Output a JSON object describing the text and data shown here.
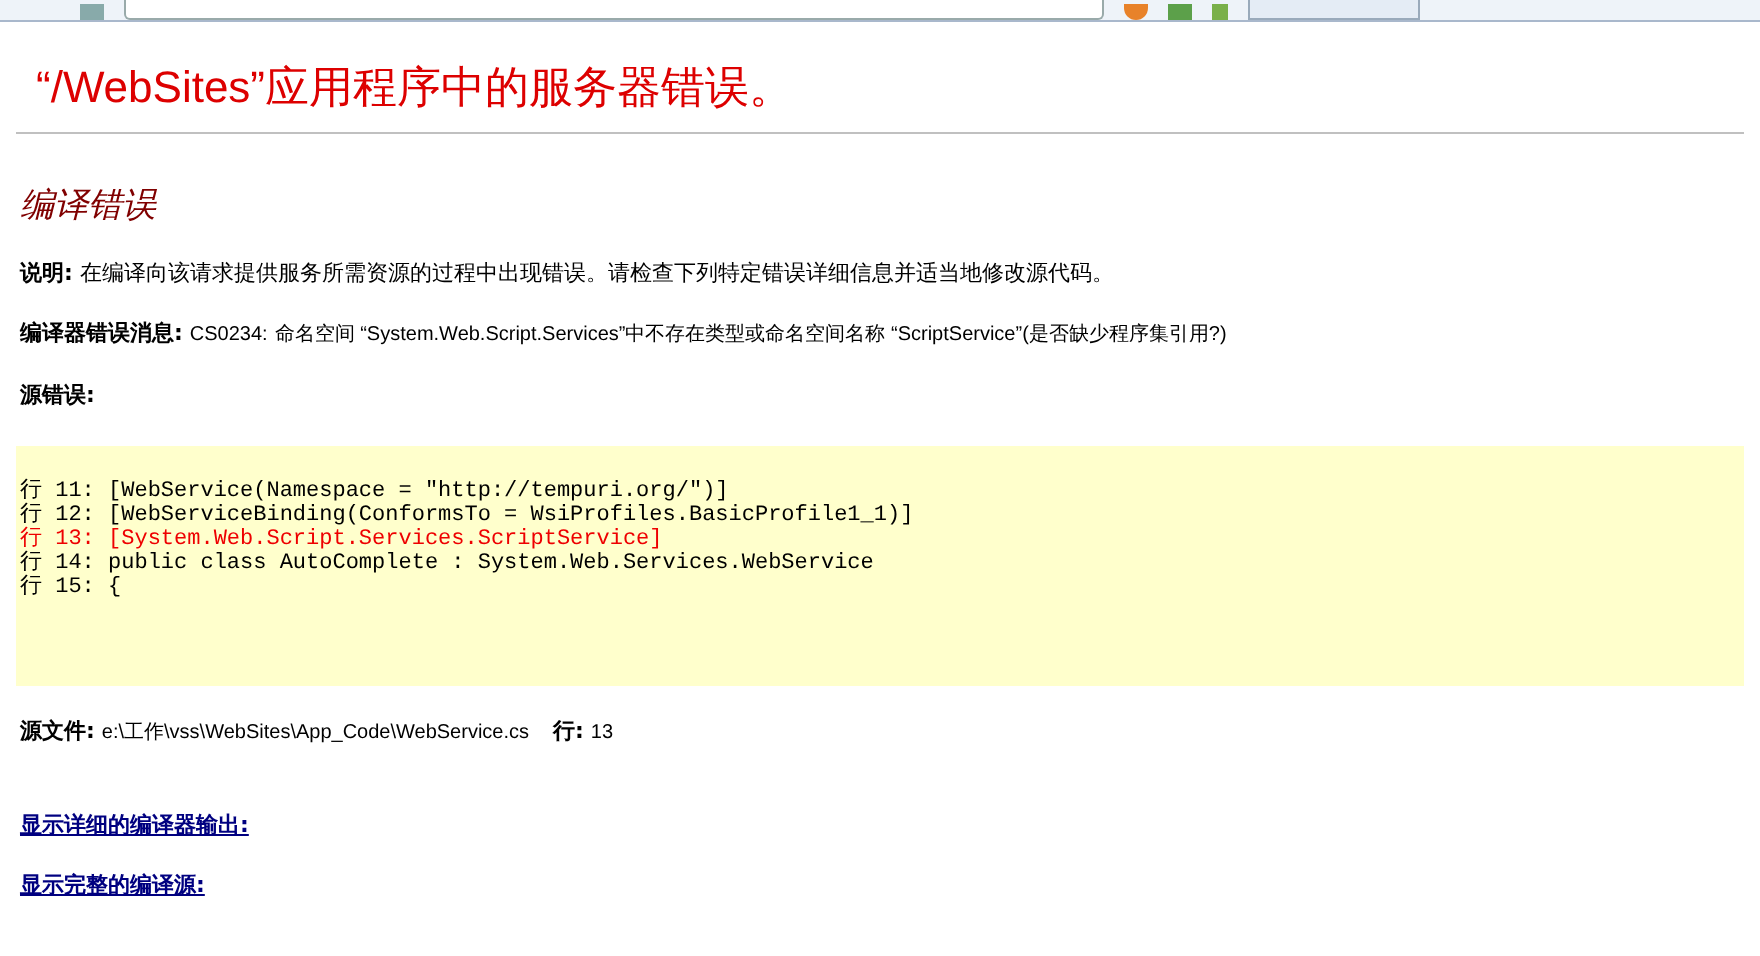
{
  "title": "“/WebSites”应用程序中的服务器错误。",
  "subtitle": "编译错误",
  "description": {
    "label": "说明:",
    "text": "在编译向该请求提供服务所需资源的过程中出现错误。请检查下列特定错误详细信息并适当地修改源代码。"
  },
  "compiler_message": {
    "label": "编译器错误消息:",
    "code": "CS0234:",
    "text": "命名空间 “System.Web.Script.Services”中不存在类型或命名空间名称 “ScriptService”(是否缺少程序集引用?)"
  },
  "source_error": {
    "label": "源错误:",
    "lines": [
      {
        "number": "行 11:",
        "code": "[WebService(Namespace = \"http://tempuri.org/\")]",
        "error": false
      },
      {
        "number": "行 12:",
        "code": "[WebServiceBinding(ConformsTo = WsiProfiles.BasicProfile1_1)]",
        "error": false
      },
      {
        "number": "行 13:",
        "code": "[System.Web.Script.Services.ScriptService]",
        "error": true
      },
      {
        "number": "行 14:",
        "code": "public class AutoComplete : System.Web.Services.WebService",
        "error": false
      },
      {
        "number": "行 15:",
        "code": "{",
        "error": false
      }
    ]
  },
  "source_file": {
    "label": "源文件:",
    "path": "e:\\工作\\vss\\WebSites\\App_Code\\WebService.cs",
    "line_label": "行:",
    "line": "13"
  },
  "links": [
    "显示详细的编译器输出:",
    "显示完整的编译源:"
  ]
}
